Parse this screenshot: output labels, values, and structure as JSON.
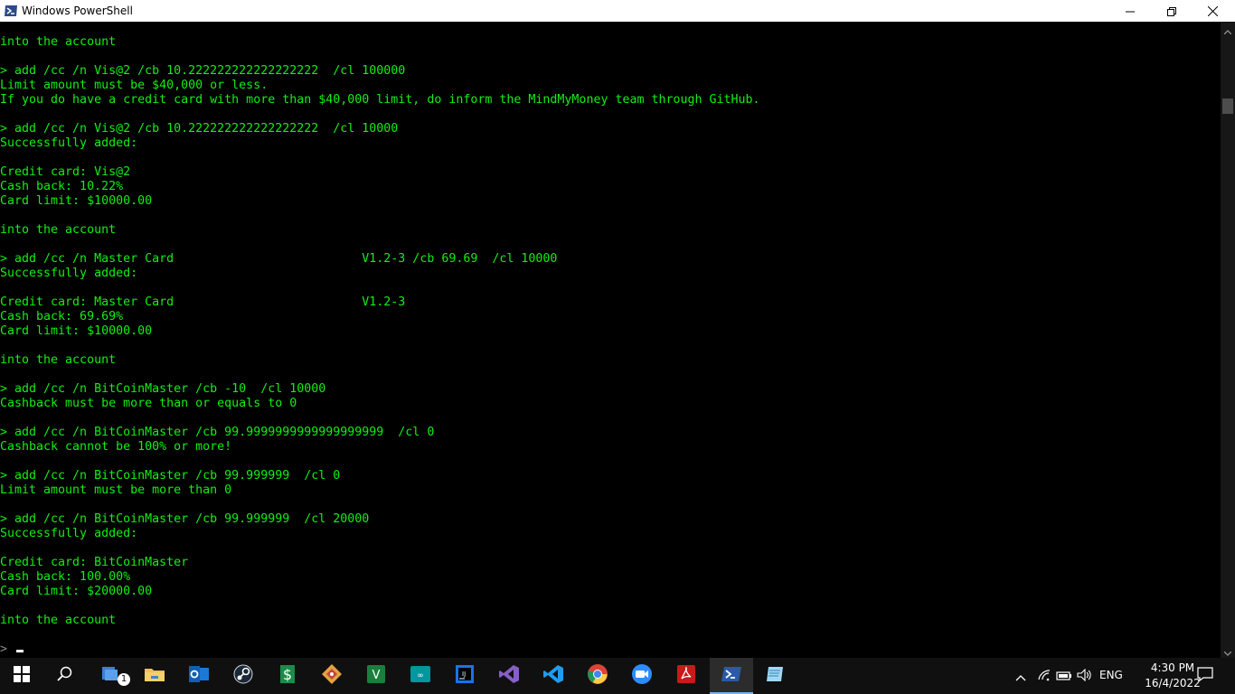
{
  "window": {
    "title": "Windows PowerShell"
  },
  "console": {
    "lines": [
      "into the account",
      "",
      "> add /cc /n Vis@2 /cb 10.222222222222222222  /cl 100000",
      "Limit amount must be $40,000 or less.",
      "If you do have a credit card with more than $40,000 limit, do inform the MindMyMoney team through GitHub.",
      "",
      "> add /cc /n Vis@2 /cb 10.222222222222222222  /cl 10000",
      "Successfully added:",
      "",
      "Credit card: Vis@2",
      "Cash back: 10.22%",
      "Card limit: $10000.00",
      "",
      "into the account",
      "",
      "> add /cc /n Master Card                          V1.2-3 /cb 69.69  /cl 10000",
      "Successfully added:",
      "",
      "Credit card: Master Card                          V1.2-3",
      "Cash back: 69.69%",
      "Card limit: $10000.00",
      "",
      "into the account",
      "",
      "> add /cc /n BitCoinMaster /cb -10  /cl 10000",
      "Cashback must be more than or equals to 0",
      "",
      "> add /cc /n BitCoinMaster /cb 99.9999999999999999999  /cl 0",
      "Cashback cannot be 100% or more!",
      "",
      "> add /cc /n BitCoinMaster /cb 99.999999  /cl 0",
      "Limit amount must be more than 0",
      "",
      "> add /cc /n BitCoinMaster /cb 99.999999  /cl 20000",
      "Successfully added:",
      "",
      "Credit card: BitCoinMaster",
      "Cash back: 100.00%",
      "Card limit: $20000.00",
      "",
      "into the account",
      ""
    ],
    "prompt": ">",
    "text_color": "#13ef13"
  },
  "taskbar": {
    "apps": [
      {
        "name": "start-button",
        "icon": "windows-logo-icon"
      },
      {
        "name": "search-button",
        "icon": "search-icon"
      },
      {
        "name": "task-view-button",
        "icon": "task-view-icon",
        "badge": "1"
      },
      {
        "name": "file-explorer",
        "icon": "folder-icon"
      },
      {
        "name": "outlook",
        "icon": "outlook-icon"
      },
      {
        "name": "steam",
        "icon": "steam-icon"
      },
      {
        "name": "sourcetree-like-app",
        "icon": "dollar-app-icon"
      },
      {
        "name": "git-app",
        "icon": "git-diamond-icon"
      },
      {
        "name": "green-app",
        "icon": "green-app-icon"
      },
      {
        "name": "arduino",
        "icon": "arduino-icon"
      },
      {
        "name": "intellij",
        "icon": "intellij-icon"
      },
      {
        "name": "visual-studio",
        "icon": "visual-studio-icon"
      },
      {
        "name": "vscode",
        "icon": "vscode-icon"
      },
      {
        "name": "chrome",
        "icon": "chrome-icon"
      },
      {
        "name": "zoom",
        "icon": "zoom-icon"
      },
      {
        "name": "acrobat",
        "icon": "acrobat-icon"
      },
      {
        "name": "powershell",
        "icon": "powershell-icon"
      },
      {
        "name": "notepad",
        "icon": "notepad-icon"
      }
    ],
    "language": "ENG",
    "time": "4:30 PM",
    "date": "16/4/2022"
  }
}
